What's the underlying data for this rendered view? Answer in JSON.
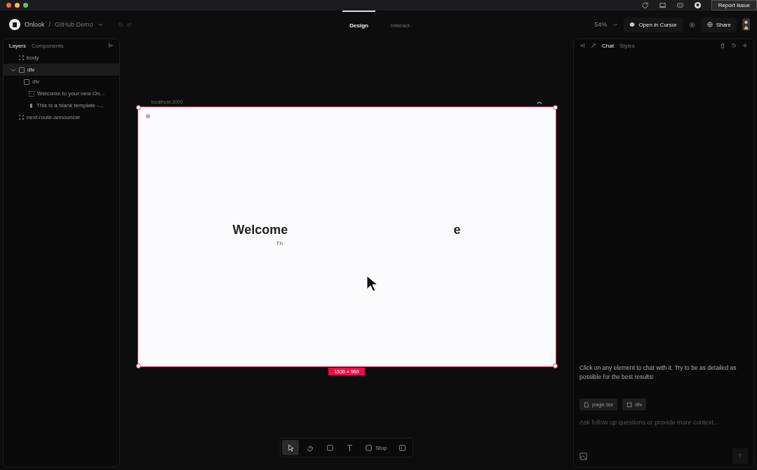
{
  "title_bar": {
    "report_button": "Report Issue"
  },
  "toolbar": {
    "project": "Onlook",
    "separator": "/",
    "branch": "GitHub Demo",
    "modes": [
      {
        "label": "Design",
        "selected": true
      },
      {
        "label": "Interact",
        "selected": false
      }
    ],
    "zoom": "54%",
    "open_button": "Open in Cursor",
    "share_button": "Share"
  },
  "left_panel": {
    "tabs": [
      {
        "label": "Layers",
        "selected": true
      },
      {
        "label": "Components",
        "selected": false
      }
    ],
    "layers": [
      {
        "label": "body",
        "kind": "component",
        "selected": false
      },
      {
        "label": "div",
        "kind": "frame",
        "selected": true,
        "expanded": true,
        "children": [
          {
            "label": "div",
            "kind": "frame",
            "selected": false,
            "children": [
              {
                "label": "Welcome to your new On...",
                "kind": "text",
                "selected": false
              },
              {
                "label": "This is a blank template -...",
                "kind": "paragraph",
                "selected": false
              }
            ]
          }
        ]
      },
      {
        "label": "next-route-announcer",
        "kind": "component",
        "selected": false
      }
    ]
  },
  "canvas": {
    "frame_url": "localhost:3000",
    "heading_start": "Welcome",
    "heading_end": "e",
    "subtitle": "Th",
    "size": "1536 × 960"
  },
  "bottom_toolbar": [
    {
      "kind": "pointer",
      "selected": true
    },
    {
      "kind": "hand",
      "selected": false
    },
    {
      "kind": "frame",
      "selected": false
    },
    {
      "kind": "text",
      "selected": false
    },
    {
      "kind": "stop",
      "label": "Stop",
      "selected": false
    },
    {
      "kind": "terminal",
      "selected": false
    }
  ],
  "right_panel": {
    "tabs": [
      {
        "label": "Chat",
        "selected": true
      },
      {
        "label": "Styles",
        "selected": false
      }
    ],
    "hint": "Click on any element to chat with it. Try to be as detailed as possible for the best results!",
    "chips": [
      {
        "kind": "file",
        "label": "page.tsx"
      },
      {
        "kind": "element",
        "label": "div"
      }
    ],
    "input": {
      "placeholder": "Ask follow up questions or provide more context..."
    }
  }
}
